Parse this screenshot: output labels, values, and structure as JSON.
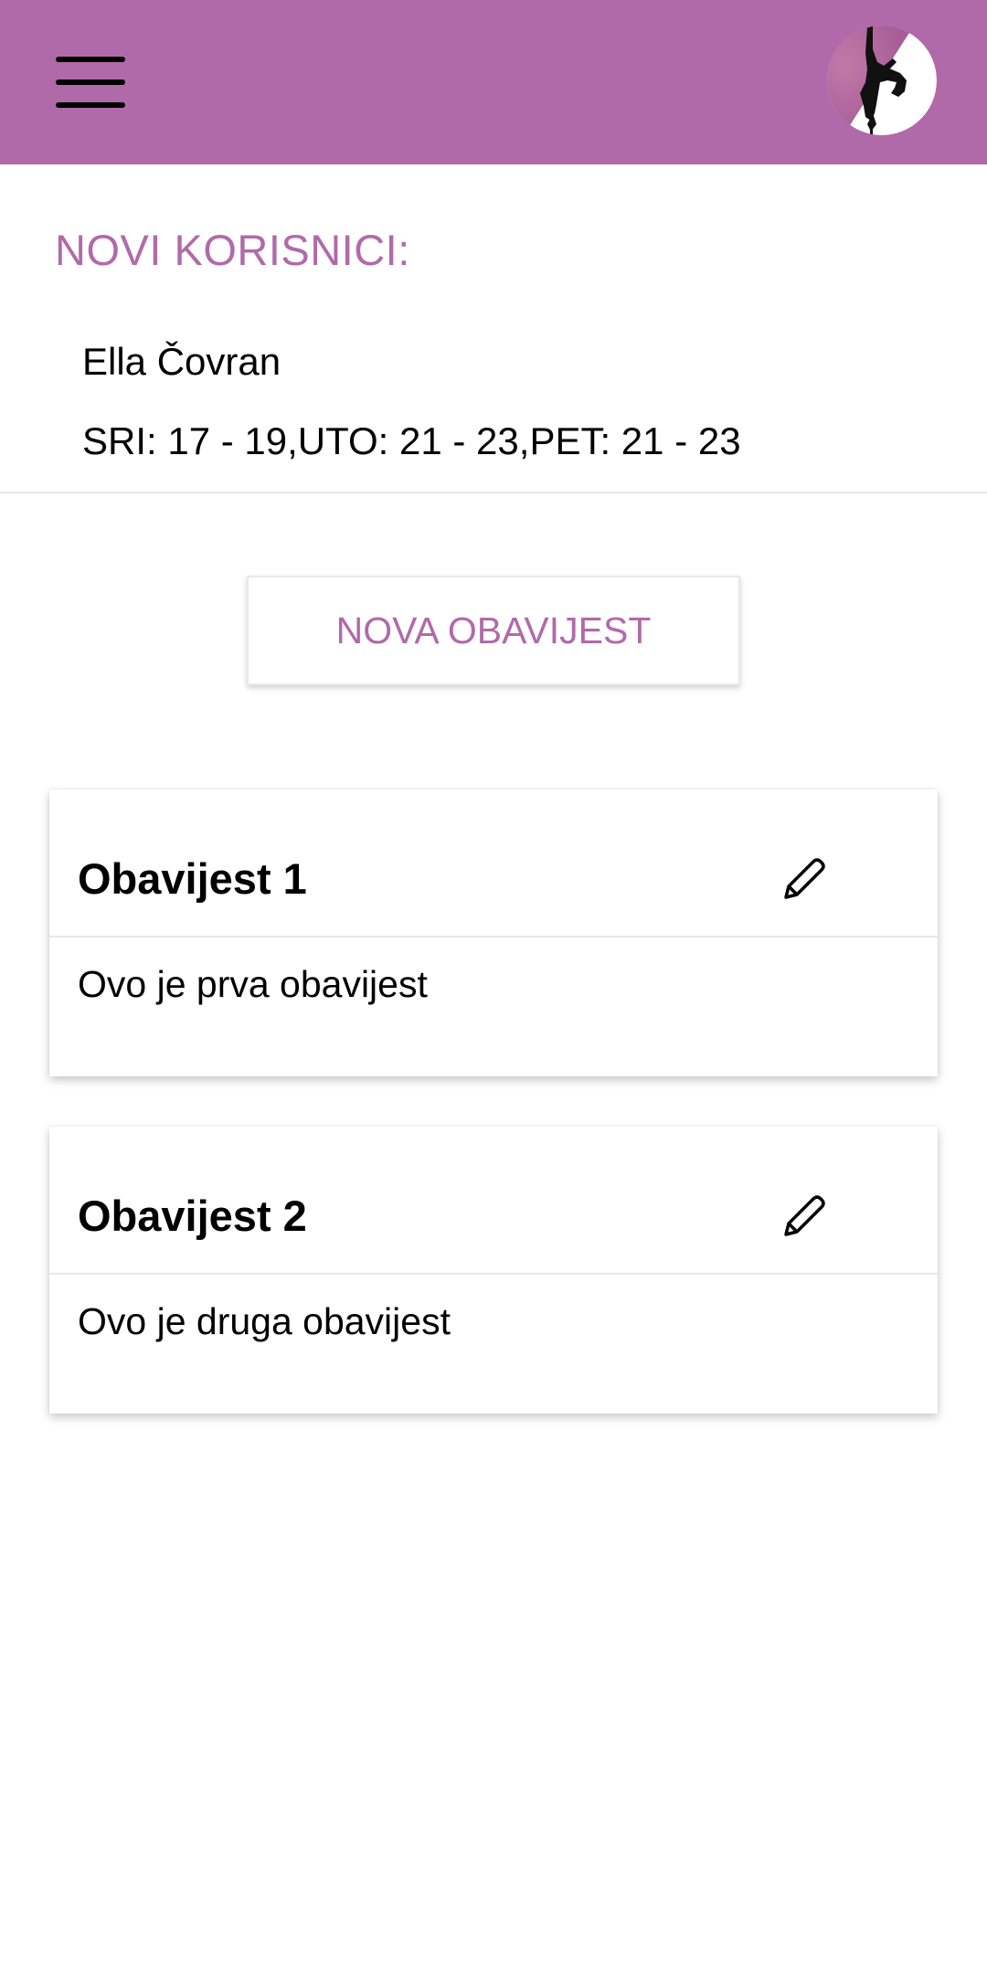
{
  "colors": {
    "primary": "#b16aa9",
    "text": "#000000",
    "background": "#ffffff"
  },
  "app_bar": {
    "menu_icon": "hamburger-menu-icon",
    "avatar_icon": "pole-dancer-logo"
  },
  "new_users": {
    "title": "NOVI KORISNICI:",
    "users": [
      {
        "name": "Ella Čovran",
        "schedule": "SRI: 17 - 19,UTO: 21 - 23,PET: 21 - 23"
      }
    ]
  },
  "new_notice_button": {
    "label": "NOVA OBAVIJEST"
  },
  "notices": [
    {
      "title": "Obavijest 1",
      "body": "Ovo je prva obavijest",
      "edit_icon": "pencil-icon"
    },
    {
      "title": "Obavijest 2",
      "body": "Ovo je druga obavijest",
      "edit_icon": "pencil-icon"
    }
  ]
}
